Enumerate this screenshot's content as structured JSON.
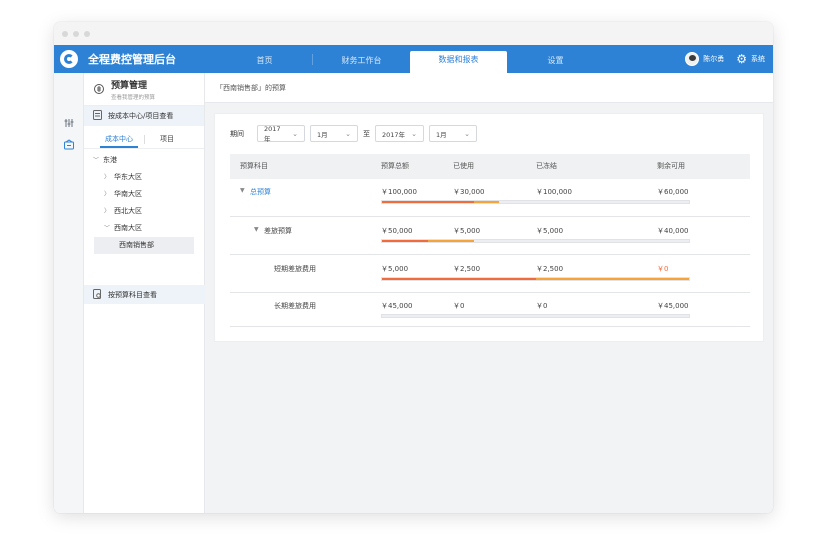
{
  "app": {
    "title": "全程费控管理后台"
  },
  "nav": {
    "tabs": [
      "首页",
      "财务工作台",
      "数据和报表",
      "设置"
    ],
    "active_index": 2
  },
  "user": {
    "name": "陈尔勇",
    "settings_label": "系统"
  },
  "sidebar": {
    "title": "预算管理",
    "subtitle": "查看我管理的预算",
    "mode_cost_center": "按成本中心/项目查看",
    "subtabs": [
      "成本中心",
      "项目"
    ],
    "tree": [
      {
        "label": "东港",
        "expanded": true
      },
      {
        "label": "华东大区",
        "expanded": false
      },
      {
        "label": "华南大区",
        "expanded": false
      },
      {
        "label": "西北大区",
        "expanded": false
      },
      {
        "label": "西南大区",
        "expanded": true
      },
      {
        "label": "西南销售部",
        "selected": true
      }
    ],
    "mode_subject": "按预算科目查看"
  },
  "breadcrumb": "「西南销售部」的预算",
  "filter": {
    "label": "期间",
    "to_label": "至",
    "from_year": "2017年",
    "from_month": "1月",
    "to_year": "2017年",
    "to_month": "1月"
  },
  "table": {
    "headers": [
      "预算科目",
      "预算总额",
      "已使用",
      "已冻结",
      "剩余可用"
    ],
    "rows": [
      {
        "name": "总预算",
        "total": "￥100,000",
        "used": "￥30,000",
        "frozen": "￥100,000",
        "remaining": "￥60,000",
        "used_ratio": 0.3,
        "frozen_ratio": 0.08
      },
      {
        "name": "差旅预算",
        "total": "￥50,000",
        "used": "￥5,000",
        "frozen": "￥5,000",
        "remaining": "￥40,000",
        "used_ratio": 0.15,
        "frozen_ratio": 0.15
      },
      {
        "name": "短期差旅费用",
        "total": "￥5,000",
        "used": "￥2,500",
        "frozen": "￥2,500",
        "remaining": "￥0",
        "used_ratio": 0.5,
        "frozen_ratio": 0.5
      },
      {
        "name": "长期差旅费用",
        "total": "￥45,000",
        "used": "￥0",
        "frozen": "￥0",
        "remaining": "￥45,000",
        "used_ratio": 0,
        "frozen_ratio": 0
      }
    ]
  },
  "colors": {
    "brand": "#2d82d5",
    "used_bar": "#f26b3a",
    "frozen_bar": "#f6a33a",
    "remaining_zero": "#f26b3a"
  }
}
